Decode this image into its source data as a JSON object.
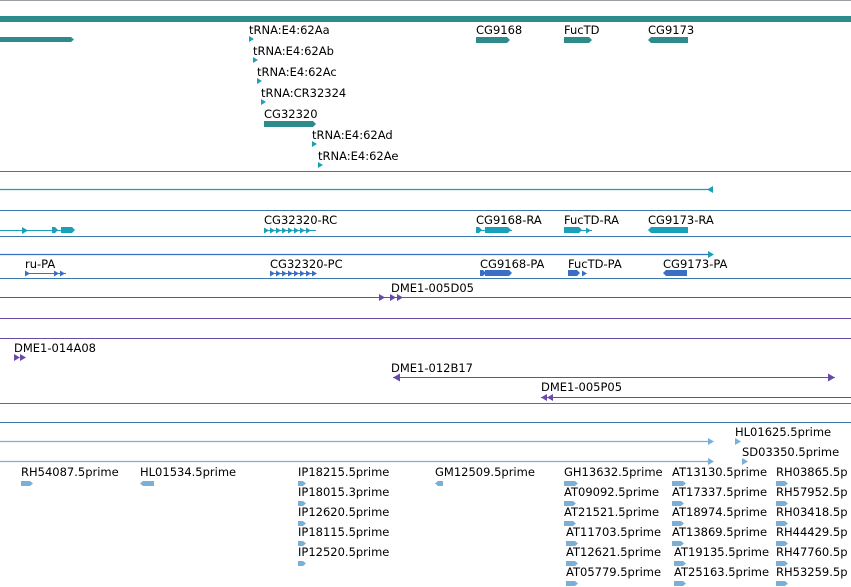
{
  "colors": {
    "gene": "#2e8b8b",
    "transcript": "#1aa0b8",
    "protein": "#3c6fc4",
    "clone": "#6a4aa8",
    "est": "#7ab0d8",
    "divider": "#3a78b0"
  },
  "genes": {
    "labels": [
      "tRNA:E4:62Aa",
      "tRNA:E4:62Ab",
      "tRNA:E4:62Ac",
      "tRNA:CR32324",
      "CG32320",
      "tRNA:E4:62Ad",
      "tRNA:E4:62Ae",
      "CG9168",
      "FucTD",
      "CG9173"
    ]
  },
  "transcripts": {
    "labels": [
      "CG32320-RC",
      "CG9168-RA",
      "FucTD-RA",
      "CG9173-RA"
    ]
  },
  "proteins": {
    "labels": [
      "ru-PA",
      "CG32320-PC",
      "CG9168-PA",
      "FucTD-PA",
      "CG9173-PA"
    ]
  },
  "clones": {
    "labels": [
      "DME1-005D05",
      "DME1-014A08",
      "DME1-012B17",
      "DME1-005P05"
    ]
  },
  "ests": {
    "top_labels": [
      "HL01625.5prime",
      "SD03350.5prime"
    ],
    "labels": [
      "RH54087.5prime",
      "HL01534.5prime",
      "IP18215.5prime",
      "IP18015.3prime",
      "IP12620.5prime",
      "IP18115.5prime",
      "IP12520.5prime",
      "GM12509.5prime",
      "GH13632.5prime",
      "AT09092.5prime",
      "AT21521.5prime",
      "AT11703.5prime",
      "AT12621.5prime",
      "AT05779.5prime",
      "AT13130.5prime",
      "AT17337.5prime",
      "AT18974.5prime",
      "AT13869.5prime",
      "AT19135.5prime",
      "AT25163.5prime",
      "RH03865.5p",
      "RH57952.5p",
      "RH03418.5p",
      "RH44429.5p",
      "RH47760.5p",
      "RH53259.5p"
    ]
  }
}
